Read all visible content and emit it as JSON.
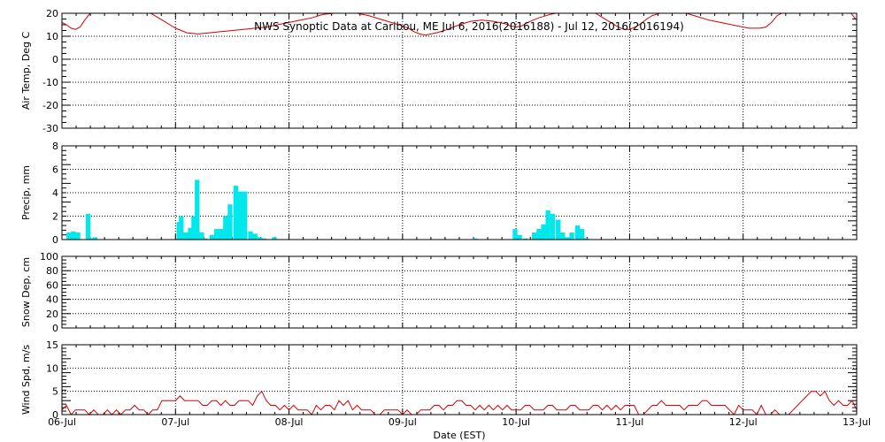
{
  "chart_title": "NWS Synoptic Data at Caribou, ME   Jul  6, 2016(2016188) - Jul 12, 2016(2016194)",
  "x_axis": {
    "label": "Date (EST)",
    "tick_labels": [
      "06-Jul",
      "07-Jul",
      "08-Jul",
      "09-Jul",
      "10-Jul",
      "11-Jul",
      "12-Jul",
      "13-Jul"
    ],
    "range_days": [
      0,
      7
    ]
  },
  "colors": {
    "temperature": "#d40000",
    "precip": "#00e8ec",
    "wind": "#d40000",
    "frame": "#000000"
  },
  "chart_data": [
    {
      "type": "line",
      "ylabel": "Air Temp, Deg C",
      "ylim": [
        -30,
        20
      ],
      "yticks": [
        20,
        10,
        0,
        -10,
        -20,
        -30
      ],
      "grid": true,
      "series": [
        {
          "x": [
            0,
            0.04,
            0.08,
            0.12,
            0.16,
            0.2,
            0.24,
            0.28,
            0.32,
            0.4,
            0.5,
            0.6,
            0.7,
            0.76,
            0.8,
            0.85,
            0.9,
            0.95,
            1.0,
            1.05,
            1.1,
            1.2,
            1.3,
            1.4,
            1.5,
            1.6,
            1.7,
            1.8,
            1.9,
            2.0,
            2.1,
            2.2,
            2.3,
            2.4,
            2.5,
            2.6,
            2.7,
            2.8,
            2.9,
            3.0,
            3.05,
            3.1,
            3.15,
            3.2,
            3.3,
            3.4,
            3.5,
            3.6,
            3.7,
            3.8,
            3.9,
            3.95,
            4.0,
            4.05,
            4.1,
            4.2,
            4.3,
            4.4,
            4.5,
            4.6,
            4.7,
            4.8,
            4.85,
            4.9,
            4.95,
            5.0,
            5.05,
            5.1,
            5.15,
            5.2,
            5.3,
            5.4,
            5.5,
            5.6,
            5.7,
            5.8,
            5.9,
            6.0,
            6.05,
            6.1,
            6.15,
            6.2,
            6.25,
            6.3,
            6.4,
            6.6,
            6.8,
            6.9,
            6.95,
            7.0
          ],
          "y": [
            16,
            15,
            13.5,
            13,
            14,
            17,
            19.5,
            20.5,
            21,
            23,
            24.5,
            24,
            22,
            20.5,
            19.5,
            18,
            16.5,
            15,
            13.5,
            12.5,
            11.5,
            11,
            11.5,
            12,
            12.5,
            13,
            13.5,
            14,
            15,
            16,
            17,
            18,
            19.5,
            20,
            20.5,
            20,
            19,
            17.5,
            16,
            14.5,
            13.5,
            12,
            11,
            10.5,
            11.5,
            13,
            15,
            16.5,
            17,
            16.5,
            15.5,
            14.5,
            14,
            14.5,
            16,
            18,
            19.5,
            20.5,
            21,
            21.5,
            20,
            17,
            15.5,
            14,
            13,
            13,
            14,
            15.5,
            17.5,
            19,
            20.5,
            21,
            20,
            18.5,
            17,
            16,
            15,
            14,
            13.5,
            13.5,
            13.5,
            14,
            16,
            19,
            21.5,
            23,
            23.5,
            22,
            20,
            17
          ]
        }
      ]
    },
    {
      "type": "bar",
      "ylabel": "Precip, mm",
      "ylim": [
        0,
        8
      ],
      "yticks": [
        0,
        2,
        4,
        6,
        8
      ],
      "grid": true,
      "bin_width_days": 0.04167,
      "series": [
        {
          "x": [
            0.04,
            0.08,
            0.12,
            0.21,
            0.25,
            0.27,
            1.01,
            1.03,
            1.07,
            1.11,
            1.14,
            1.17,
            1.21,
            1.24,
            1.3,
            1.34,
            1.38,
            1.42,
            1.46,
            1.51,
            1.55,
            1.59,
            1.64,
            1.68,
            1.72,
            1.76,
            1.85,
            3.62,
            3.97,
            4.01,
            4.06,
            4.14,
            4.18,
            4.22,
            4.26,
            4.3,
            4.35,
            4.39,
            4.43,
            4.47,
            4.52,
            4.56,
            4.6
          ],
          "values": [
            0.6,
            0.7,
            0.6,
            2.2,
            0.1,
            0.2,
            1.5,
            2.0,
            0.6,
            1.0,
            2.0,
            5.1,
            0.6,
            0.1,
            0.4,
            0.9,
            0.9,
            2.0,
            3.0,
            4.6,
            4.1,
            4.1,
            0.7,
            0.5,
            0.2,
            0.1,
            0.2,
            0.1,
            0.9,
            0.4,
            0.1,
            0.6,
            0.9,
            1.3,
            2.5,
            2.2,
            1.7,
            0.6,
            0.2,
            0.6,
            1.2,
            0.9,
            0.1
          ]
        }
      ]
    },
    {
      "type": "line",
      "ylabel": "Snow Dep, cm",
      "ylim": [
        0,
        100
      ],
      "yticks": [
        0,
        20,
        40,
        60,
        80,
        100
      ],
      "grid": true,
      "series": []
    },
    {
      "type": "line",
      "ylabel": "Wind Spd, m/s",
      "ylim": [
        0,
        15
      ],
      "yticks": [
        0,
        5,
        10,
        15
      ],
      "grid": true,
      "series": [
        {
          "x": [
            0,
            0.04,
            0.08,
            0.12,
            0.16,
            0.2,
            0.24,
            0.28,
            0.32,
            0.36,
            0.4,
            0.44,
            0.48,
            0.52,
            0.56,
            0.6,
            0.64,
            0.68,
            0.72,
            0.76,
            0.8,
            0.84,
            0.88,
            0.92,
            0.96,
            1.0,
            1.04,
            1.08,
            1.12,
            1.16,
            1.2,
            1.24,
            1.28,
            1.32,
            1.36,
            1.4,
            1.44,
            1.48,
            1.52,
            1.56,
            1.6,
            1.64,
            1.68,
            1.72,
            1.76,
            1.8,
            1.84,
            1.88,
            1.92,
            1.96,
            2.0,
            2.04,
            2.08,
            2.12,
            2.16,
            2.2,
            2.24,
            2.28,
            2.32,
            2.36,
            2.4,
            2.44,
            2.48,
            2.52,
            2.56,
            2.6,
            2.64,
            2.68,
            2.72,
            2.76,
            2.8,
            2.84,
            2.88,
            2.92,
            2.96,
            3.0,
            3.04,
            3.08,
            3.12,
            3.16,
            3.2,
            3.24,
            3.28,
            3.32,
            3.36,
            3.4,
            3.44,
            3.48,
            3.52,
            3.56,
            3.6,
            3.64,
            3.68,
            3.72,
            3.76,
            3.8,
            3.84,
            3.88,
            3.92,
            3.96,
            4.0,
            4.04,
            4.08,
            4.12,
            4.16,
            4.2,
            4.24,
            4.28,
            4.32,
            4.36,
            4.4,
            4.44,
            4.48,
            4.52,
            4.56,
            4.6,
            4.64,
            4.68,
            4.72,
            4.76,
            4.8,
            4.84,
            4.88,
            4.92,
            4.96,
            5.0,
            5.04,
            5.08,
            5.12,
            5.16,
            5.2,
            5.24,
            5.28,
            5.32,
            5.36,
            5.4,
            5.44,
            5.48,
            5.52,
            5.56,
            5.6,
            5.64,
            5.68,
            5.72,
            5.76,
            5.8,
            5.84,
            5.88,
            5.92,
            5.96,
            6.0,
            6.04,
            6.08,
            6.12,
            6.16,
            6.2,
            6.24,
            6.28,
            6.32,
            6.36,
            6.4,
            6.44,
            6.48,
            6.52,
            6.56,
            6.6,
            6.64,
            6.68,
            6.72,
            6.76,
            6.8,
            6.84,
            6.88,
            6.92,
            6.96,
            7.0
          ],
          "y": [
            1,
            2,
            0,
            1,
            1,
            1,
            0,
            1,
            0,
            0,
            1,
            0,
            1,
            0,
            1,
            1,
            2,
            1,
            1,
            0,
            1,
            1,
            3,
            3,
            3,
            3,
            4,
            3,
            3,
            3,
            3,
            2,
            2,
            3,
            3,
            2,
            3,
            2,
            2,
            3,
            3,
            3,
            2,
            4,
            5,
            3,
            2,
            2,
            1,
            2,
            1,
            2,
            1,
            1,
            1,
            0,
            2,
            1,
            2,
            2,
            1,
            3,
            2,
            3,
            1,
            2,
            1,
            1,
            1,
            0,
            0,
            1,
            1,
            1,
            1,
            0,
            1,
            0,
            0,
            1,
            1,
            1,
            2,
            2,
            1,
            2,
            2,
            3,
            3,
            2,
            2,
            1,
            2,
            1,
            2,
            1,
            2,
            1,
            2,
            1,
            1,
            1,
            2,
            2,
            1,
            1,
            1,
            2,
            2,
            1,
            1,
            1,
            2,
            2,
            1,
            1,
            1,
            2,
            2,
            1,
            2,
            1,
            2,
            1,
            2,
            2,
            2,
            0,
            0,
            1,
            2,
            2,
            3,
            2,
            2,
            2,
            2,
            1,
            2,
            2,
            2,
            3,
            3,
            2,
            2,
            2,
            2,
            1,
            0,
            2,
            1,
            1,
            1,
            0,
            2,
            0,
            0,
            1,
            0,
            0,
            0,
            1,
            2,
            3,
            4,
            5,
            5,
            4,
            5,
            3,
            2,
            3,
            2,
            2,
            3,
            1
          ]
        }
      ]
    }
  ]
}
